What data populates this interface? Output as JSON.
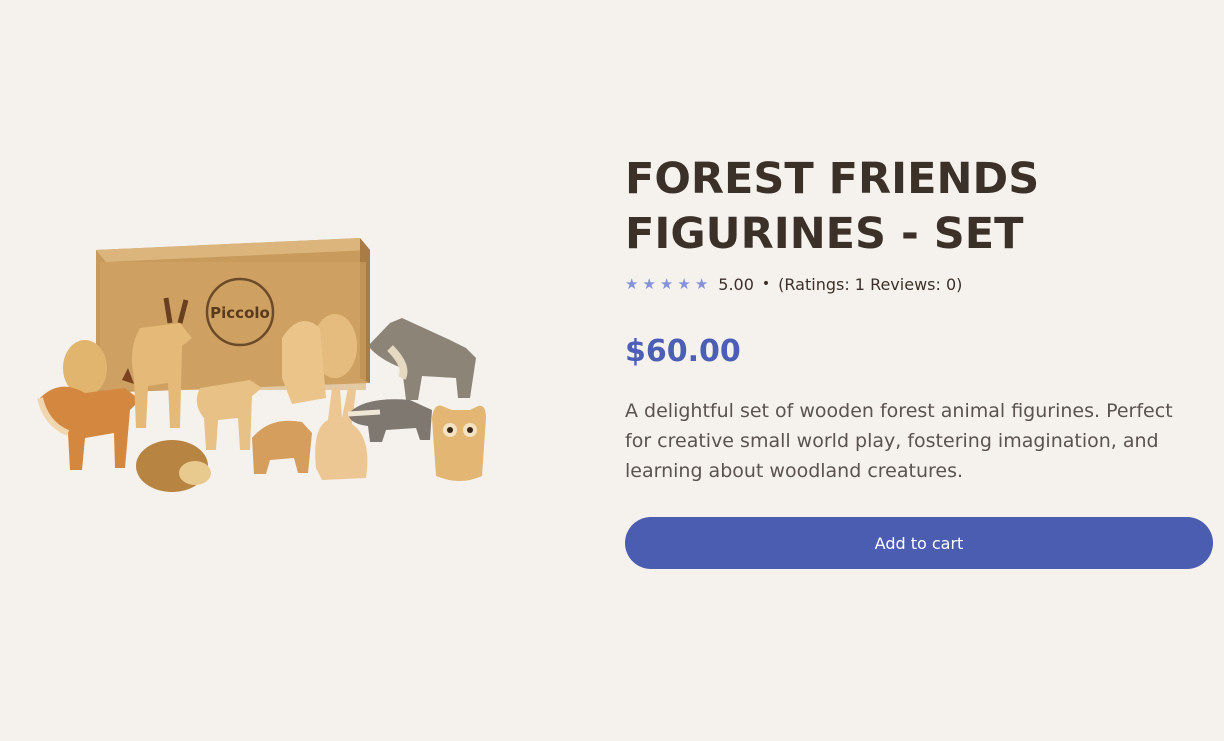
{
  "product": {
    "title": "FOREST FRIENDS FIGURINES - SET",
    "rating": {
      "stars": 5,
      "value": "5.00",
      "separator": "•",
      "summary": "(Ratings: 1 Reviews: 0)",
      "star_color": "#8592d8"
    },
    "price": "$60.00",
    "description": "A delightful set of wooden forest animal figurines. Perfect for creative small world play, fostering imagination, and learning about woodland creatures.",
    "add_to_cart_label": "Add to cart",
    "image": {
      "box_logo_text": "Piccolo"
    }
  },
  "colors": {
    "background": "#f5f1ed",
    "title": "#3b3128",
    "price": "#4a5fb5",
    "button": "#4a5db1"
  }
}
